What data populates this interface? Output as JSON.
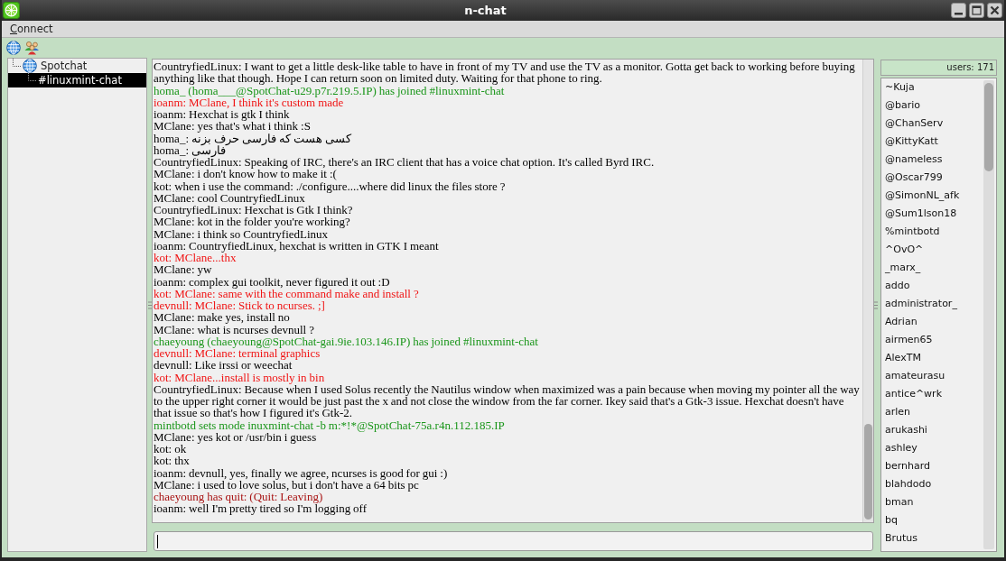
{
  "window": {
    "title": "n-chat"
  },
  "menu": [
    {
      "label": "Connect"
    }
  ],
  "server_tree": [
    {
      "label": "Spotchat",
      "kind": "server",
      "selected": false,
      "children": [
        {
          "label": "#linuxmint-chat",
          "kind": "channel",
          "selected": true
        }
      ]
    }
  ],
  "chat": {
    "messages": [
      {
        "text": "CountryfiedLinux: I want to get a little desk-like table to have in front of my TV and use the TV as a monitor. Gotta get back to working before buying anything like that though. Hope I can return soon on limited duty. Waiting for that phone to ring.",
        "color": "#000000"
      },
      {
        "text": "homa_ (homa___@SpotChat-u29.p7r.219.5.IP) has joined #linuxmint-chat",
        "color": "#1a961a"
      },
      {
        "text": "ioanm: MClane, I think it's custom made",
        "color": "#f01414"
      },
      {
        "text": "ioanm: Hexchat is gtk I think",
        "color": "#000000"
      },
      {
        "text": "MClane: yes that's what i think :S",
        "color": "#000000"
      },
      {
        "text": "homa_: کسی هست که فارسی حرف بزنه",
        "color": "#000000"
      },
      {
        "text": "homa_: فارسی",
        "color": "#000000"
      },
      {
        "text": "CountryfiedLinux: Speaking of IRC, there's an IRC client that has a voice chat option. It's called Byrd IRC.",
        "color": "#000000"
      },
      {
        "text": "MClane: i don't know how to make it :(",
        "color": "#000000"
      },
      {
        "text": "kot: when i use the command: ./configure....where did linux the files store ?",
        "color": "#000000"
      },
      {
        "text": "MClane: cool CountryfiedLinux",
        "color": "#000000"
      },
      {
        "text": "CountryfiedLinux: Hexchat is Gtk I think?",
        "color": "#000000"
      },
      {
        "text": "MClane: kot in the folder you're working?",
        "color": "#000000"
      },
      {
        "text": "MClane: i think so CountryfiedLinux",
        "color": "#000000"
      },
      {
        "text": "ioanm: CountryfiedLinux, hexchat is written in GTK I meant",
        "color": "#000000"
      },
      {
        "text": "kot: MClane...thx",
        "color": "#f01414"
      },
      {
        "text": "MClane: yw",
        "color": "#000000"
      },
      {
        "text": "ioanm: complex gui toolkit, never figured it out :D",
        "color": "#000000"
      },
      {
        "text": "kot: MClane: same with the command make and install ?",
        "color": "#f01414"
      },
      {
        "text": "devnull: MClane: Stick to ncurses. ;]",
        "color": "#f01414"
      },
      {
        "text": "MClane: make yes, install no",
        "color": "#000000"
      },
      {
        "text": "MClane: what is ncurses devnull ?",
        "color": "#000000"
      },
      {
        "text": "chaeyoung (chaeyoung@SpotChat-gai.9ie.103.146.IP) has joined #linuxmint-chat",
        "color": "#1a961a"
      },
      {
        "text": "devnull: MClane: terminal graphics",
        "color": "#f01414"
      },
      {
        "text": "devnull: Like irssi or weechat",
        "color": "#000000"
      },
      {
        "text": "kot: MClane...install is mostly in bin",
        "color": "#f01414"
      },
      {
        "text": "CountryfiedLinux: Because when I used Solus recently the Nautilus window when maximized was a pain because when moving my pointer all the way to the upper right corner it would be just past the x and not close the window from the far corner. Ikey said that's a Gtk-3 issue. Hexchat doesn't have that issue so that's how I figured it's Gtk-2.",
        "color": "#000000"
      },
      {
        "text": "mintbotd sets mode inuxmint-chat -b m:*!*@SpotChat-75a.r4n.112.185.IP",
        "color": "#1a961a"
      },
      {
        "text": "MClane: yes kot or /usr/bin i guess",
        "color": "#000000"
      },
      {
        "text": "kot: ok",
        "color": "#000000"
      },
      {
        "text": "kot: thx",
        "color": "#000000"
      },
      {
        "text": "ioanm: devnull, yes, finally we agree, ncurses is good for gui :)",
        "color": "#000000"
      },
      {
        "text": "MClane: i used to love solus, but i don't have a 64 bits pc",
        "color": "#000000"
      },
      {
        "text": "chaeyoung has quit: (Quit: Leaving)",
        "color": "#a81414"
      },
      {
        "text": "ioanm: well I'm pretty tired so I'm logging off",
        "color": "#000000"
      }
    ]
  },
  "user_list": {
    "header": "users: 171",
    "users": [
      "~Kuja",
      "@bario",
      "@ChanServ",
      "@KittyKatt",
      "@nameless",
      "@Oscar799",
      "@SimonNL_afk",
      "@Sum1lson18",
      "%mintbotd",
      "^OvO^",
      "_marx_",
      "addo",
      "administrator_",
      "Adrian",
      "airmen65",
      "AlexTM",
      "amateurasu",
      "antice^wrk",
      "arlen",
      "arukashi",
      "ashley",
      "bernhard",
      "blahdodo",
      "bman",
      "bq",
      "Brutus"
    ]
  }
}
